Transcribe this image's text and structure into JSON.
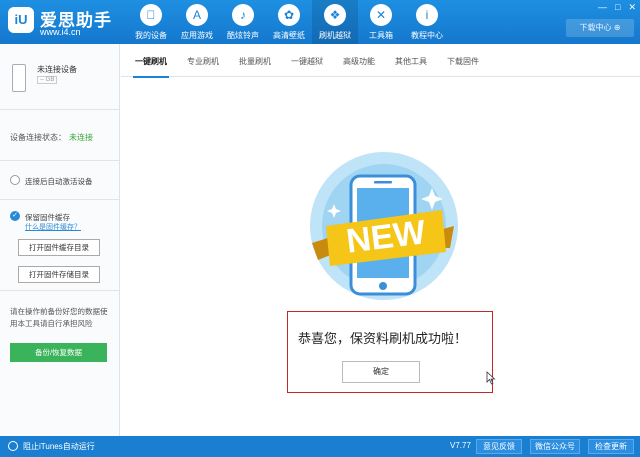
{
  "app": {
    "name": "爱思助手",
    "url": "www.i4.cn",
    "logo_mark": "iU"
  },
  "nav": {
    "items": [
      {
        "label": "我的设备",
        "icon": "apple-icon",
        "glyph": ""
      },
      {
        "label": "应用游戏",
        "icon": "app-store-icon",
        "glyph": "A"
      },
      {
        "label": "酷炫铃声",
        "icon": "bell-icon",
        "glyph": "♪"
      },
      {
        "label": "高清壁纸",
        "icon": "flower-icon",
        "glyph": "✿"
      },
      {
        "label": "刷机越狱",
        "icon": "dropbox-icon",
        "glyph": "❖"
      },
      {
        "label": "工具箱",
        "icon": "tools-icon",
        "glyph": "✕"
      },
      {
        "label": "教程中心",
        "icon": "info-icon",
        "glyph": "i"
      }
    ],
    "active_index": 4
  },
  "window": {
    "download_center": "下载中心 ⊕",
    "controls": [
      "—",
      "□",
      "✕"
    ]
  },
  "sidebar": {
    "device_name": "未连接设备",
    "device_capacity": "-- GB",
    "status_label": "设备连接状态：",
    "status_value": "未连接",
    "auto_activate": "连接后自动激活设备",
    "keep_firmware": "保留固件缓存",
    "what_is_firmware": "什么是固件缓存？",
    "open_cache_dir": "打开固件缓存目录",
    "open_store_dir": "打开固件存储目录",
    "backup_hint": "请在操作前备份好您的数据使用本工具请自行承担风险",
    "backup_button": "备份/恢复数据"
  },
  "tabs": [
    {
      "label": "一键刷机"
    },
    {
      "label": "专业刷机"
    },
    {
      "label": "批量刷机"
    },
    {
      "label": "一键越狱"
    },
    {
      "label": "高级功能"
    },
    {
      "label": "其他工具"
    },
    {
      "label": "下载固件"
    }
  ],
  "active_tab": 0,
  "dialog": {
    "message": "恭喜您，保资料刷机成功啦！",
    "ok_button": "确定",
    "banner_text": "NEW"
  },
  "footer": {
    "itunes": "阻止iTunes自动运行",
    "version": "V7.77",
    "feedback": "意见反馈",
    "wechat": "微信公众号",
    "update": "检查更新"
  },
  "colors": {
    "primary": "#1a83d8",
    "success": "#3ab35a",
    "dialog_border": "#c62828",
    "banner": "#f5c518"
  }
}
